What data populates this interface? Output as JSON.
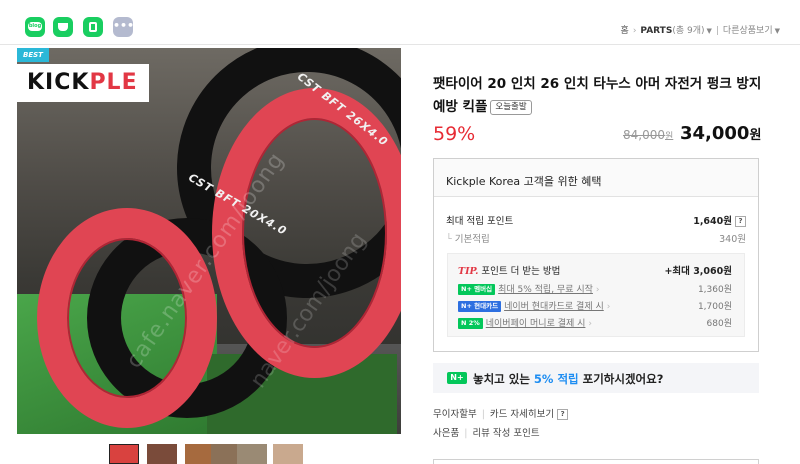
{
  "share": {
    "blog_label": "blog",
    "more_label": "•••"
  },
  "breadcrumb": {
    "home": "홈",
    "category": "PARTS",
    "count": "(총 9개)",
    "other": "다른상품보기"
  },
  "image": {
    "badge": "BEST",
    "logo_prefix": "KICK",
    "logo_mid": "PLE",
    "tire_text_back": "CST BFT 26X4.0",
    "tire_text_front": "CST BFT 20X4.0",
    "watermark": "cafe.naver.com/joong",
    "watermark2": "naver.com/joong"
  },
  "thumbnails": {
    "colors": [
      "#d9423f",
      "#7a4b3a",
      "#a66a3e",
      "#8b7158",
      "#9a8a74",
      "#c9a98e"
    ]
  },
  "product": {
    "title": "팻타이어 20 인치 26 인치 타누스 아머 자전거 펑크 방지 예방 킥플",
    "tag_today": "오늘출발",
    "discount": "59%",
    "original_price": "84,000",
    "original_unit": "원",
    "price": "34,000",
    "price_unit": "원"
  },
  "benefit": {
    "heading": "Kickple Korea 고객을 위한 혜택",
    "max_points_label": "최대 적립 포인트",
    "max_points_value": "1,640원",
    "base_label": "기본적립",
    "base_value": "340원",
    "tip_label": "TIP.",
    "tip_text": "포인트 더 받는 방법",
    "tip_max": "+최대 3,060원",
    "rows": [
      {
        "badge": "N+ 멤버십",
        "text": "최대 5% 적립, 무료 시작",
        "value": "1,360원"
      },
      {
        "badge": "N+ 현대카드",
        "text": "네이버 현대카드로 결제 시",
        "value": "1,700원"
      },
      {
        "badge": "N 2%",
        "text": "네이버페이 머니로 결제 시",
        "value": "680원"
      }
    ],
    "question_mark": "?",
    "chevron": "›"
  },
  "banner": {
    "badge": "N+",
    "text_before": "놓치고 있는 ",
    "text_highlight": "5% 적립",
    "text_after": " 포기하시겠어요?"
  },
  "links": {
    "interest_free": "무이자할부",
    "card_detail": "카드 자세히보기",
    "gift": "사은품",
    "review_points": "리뷰 작성 포인트"
  },
  "colors": {
    "accent_red": "#e72b34",
    "naver_green": "#03c75a",
    "highlight_blue": "#1d8df2"
  }
}
